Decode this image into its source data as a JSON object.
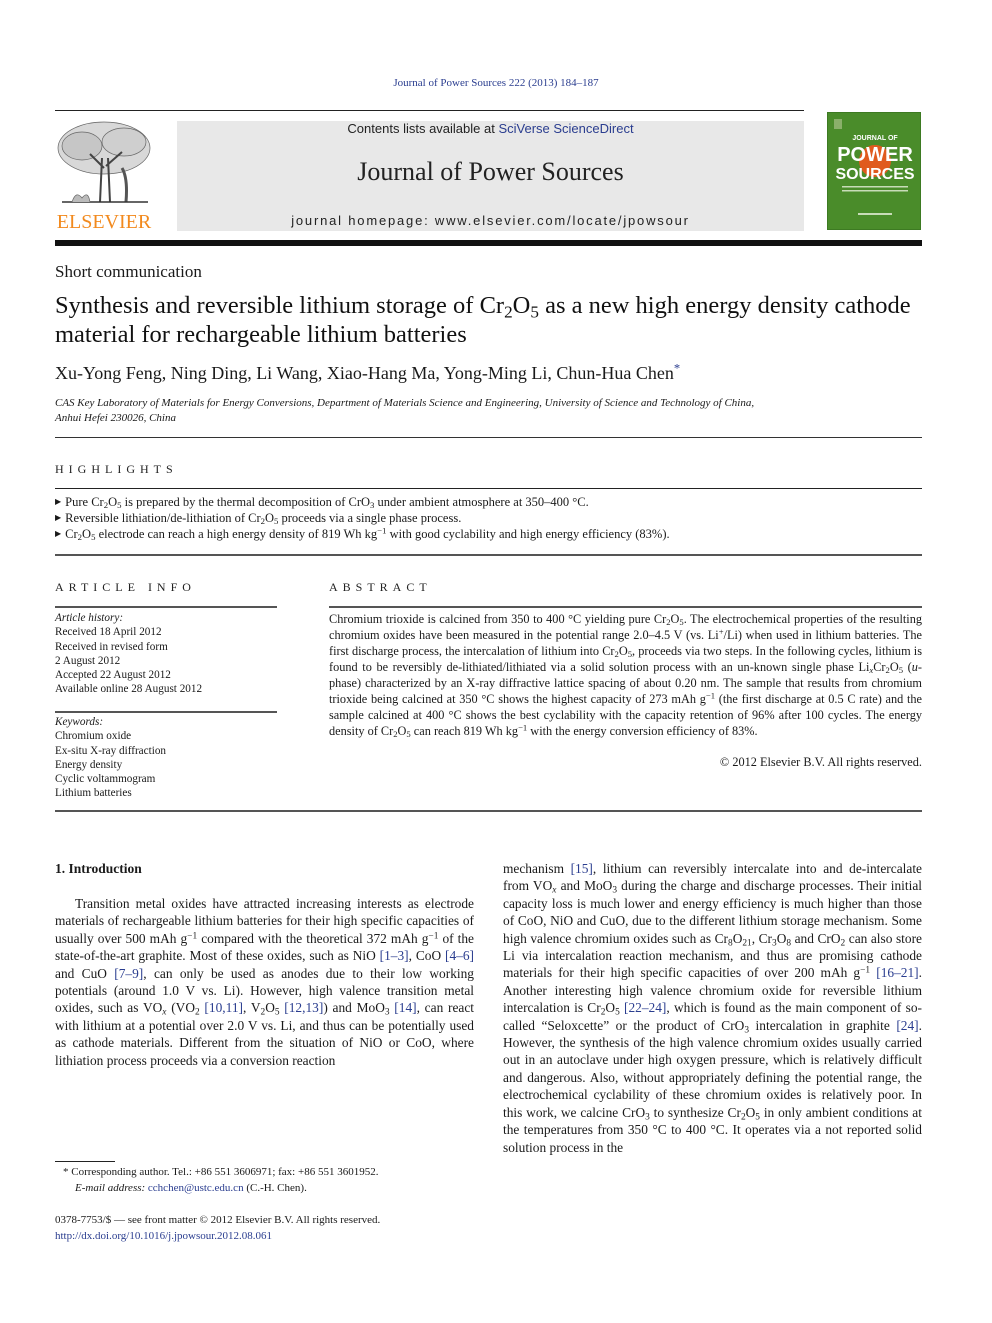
{
  "running_head": "Journal of Power Sources 222 (2013) 184–187",
  "header": {
    "publisher_logo_text": "ELSEVIER",
    "contents_prefix": "Contents lists available at ",
    "contents_link": "SciVerse ScienceDirect",
    "journal_title": "Journal of Power Sources",
    "homepage_prefix": "journal homepage: ",
    "homepage_url": "www.elsevier.com/locate/jpowsour",
    "cover": {
      "line1": "JOURNAL OF",
      "line2": "POWER",
      "line3": "SOURCES"
    },
    "colors": {
      "link": "#2a3d8f",
      "elsevier_orange": "#f28a1e",
      "cover_green": "#4a8c2a",
      "cover_orange": "#e05a1e"
    }
  },
  "article": {
    "type": "Short communication",
    "title_part1": "Synthesis and reversible lithium storage of Cr",
    "title_sub1": "2",
    "title_part2": "O",
    "title_sub2": "5",
    "title_part3": " as a new high energy density cathode material for rechargeable lithium batteries",
    "authors": "Xu-Yong Feng, Ning Ding, Li Wang, Xiao-Hang Ma, Yong-Ming Li, Chun-Hua Chen",
    "corresponding_mark": "*",
    "affiliation_line1": "CAS Key Laboratory of Materials for Energy Conversions, Department of Materials Science and Engineering, University of Science and Technology of China,",
    "affiliation_line2": "Anhui Hefei 230026, China"
  },
  "highlights": {
    "title": "HIGHLIGHTS",
    "items": [
      {
        "a": "Pure Cr",
        "s1": "2",
        "b": "O",
        "s2": "5",
        "c": " is prepared by the thermal decomposition of CrO",
        "s3": "3",
        "d": " under ambient atmosphere at 350–400 °C."
      },
      {
        "a": "Reversible lithiation/de-lithiation of Cr",
        "s1": "2",
        "b": "O",
        "s2": "5",
        "c": " proceeds via a single phase process."
      },
      {
        "a": "Cr",
        "s1": "2",
        "b": "O",
        "s2": "5",
        "c": " electrode can reach a high energy density of 819 Wh kg",
        "sup": "−1",
        "d": " with good cyclability and high energy efficiency (83%)."
      }
    ]
  },
  "article_info": {
    "title": "ARTICLE INFO",
    "history_label": "Article history:",
    "history": [
      "Received 18 April 2012",
      "Received in revised form",
      "2 August 2012",
      "Accepted 22 August 2012",
      "Available online 28 August 2012"
    ],
    "keywords_label": "Keywords:",
    "keywords": [
      "Chromium oxide",
      "Ex-situ X-ray diffraction",
      "Energy density",
      "Cyclic voltammogram",
      "Lithium batteries"
    ]
  },
  "abstract": {
    "title": "ABSTRACT",
    "p1": "Chromium trioxide is calcined from 350 to 400 °C yielding pure Cr",
    "p2": "O",
    "p3": ". The electrochemical properties of the resulting chromium oxides have been measured in the potential range 2.0–4.5 V (vs. Li",
    "p3sup": "+",
    "p4": "/Li) when used in lithium batteries. The first discharge process, the intercalation of lithium into Cr",
    "p5": "O",
    "p6": ", proceeds via two steps. In the following cycles, lithium is found to be reversibly de-lithiated/lithiated via a solid solution process with an un-known single phase Li",
    "p6sub": "x",
    "p7": "Cr",
    "p8": "O",
    "p9": " (",
    "p9it": "u",
    "p10": "-phase) characterized by an X-ray diffractive lattice spacing of about 0.20 nm. The sample that results from chromium trioxide being calcined at 350 °C shows the highest capacity of 273 mAh g",
    "p11": " (the first discharge at 0.5 C rate) and the sample calcined at 400 °C shows the best cyclability with the capacity retention of 96% after 100 cycles. The energy density of Cr",
    "p12": "O",
    "p13": " can reach 819 Wh kg",
    "p14": " with the energy conversion efficiency of 83%.",
    "copyright": "© 2012 Elsevier B.V. All rights reserved."
  },
  "intro": {
    "heading": "1.  Introduction",
    "left": [
      "Transition metal oxides have attracted increasing interests as electrode materials of rechargeable lithium batteries for their high specific capacities of usually over 500 mAh g",
      " compared with the theoretical 372 mAh g",
      " of the state-of-the-art graphite. Most of these oxides, such as NiO ",
      "[1–3]",
      ", CoO ",
      "[4–6]",
      " and CuO ",
      "[7–9]",
      ", can only be used as anodes due to their low working potentials (around 1.0 V vs. Li). However, high valence transition metal oxides, such as VO",
      " (VO",
      " ",
      "[10,11]",
      ", V",
      "O",
      " ",
      "[12,13]",
      ") and MoO",
      " ",
      "[14]",
      ", can react with lithium at a potential over 2.0 V vs. Li, and thus can be potentially used as cathode materials. Different from the situation of NiO or CoO, where lithiation process proceeds via a conversion reaction"
    ],
    "right": [
      "mechanism ",
      "[15]",
      ", lithium can reversibly intercalate into and de-intercalate from VO",
      " and MoO",
      " during the charge and discharge processes. Their initial capacity loss is much lower and energy efficiency is much higher than those of CoO, NiO and CuO, due to the different lithium storage mechanism. Some high valence chromium oxides such as Cr",
      "O",
      ", Cr",
      "O",
      " and CrO",
      " can also store Li via intercalation reaction mechanism, and thus are promising cathode materials for their high specific capacities of over 200 mAh g",
      " ",
      "[16–21]",
      ". Another interesting high valence chromium oxide for reversible lithium intercalation is Cr",
      "O",
      " ",
      "[22–24]",
      ", which is found as the main component of so-called “Seloxcette” or the product of CrO",
      " intercalation in graphite ",
      "[24]",
      ". However, the synthesis of the high valence chromium oxides usually carried out in an autoclave under high oxygen pressure, which is relatively difficult and dangerous. Also, without appropriately defining the potential range, the electrochemical cyclability of these chromium oxides is relatively poor. In this work, we calcine CrO",
      " to synthesize Cr",
      "O",
      " in only ambient conditions at the temperatures from 350 °C to 400 °C. It operates via a not reported solid solution process in the"
    ]
  },
  "footnote": {
    "mark": "*",
    "text": " Corresponding author. Tel.: +86 551 3606971; fax: +86 551 3601952.",
    "email_label": "E-mail address:",
    "email": "cchchen@ustc.edu.cn",
    "email_suffix": " (C.-H. Chen)."
  },
  "issn": {
    "line": "0378-7753/$ — see front matter © 2012 Elsevier B.V. All rights reserved.",
    "doi": "http://dx.doi.org/10.1016/j.jpowsour.2012.08.061"
  },
  "sub": {
    "two": "2",
    "three": "3",
    "five": "5",
    "eight": "8",
    "twentyone": "21",
    "x": "x",
    "minus1": "−1"
  }
}
